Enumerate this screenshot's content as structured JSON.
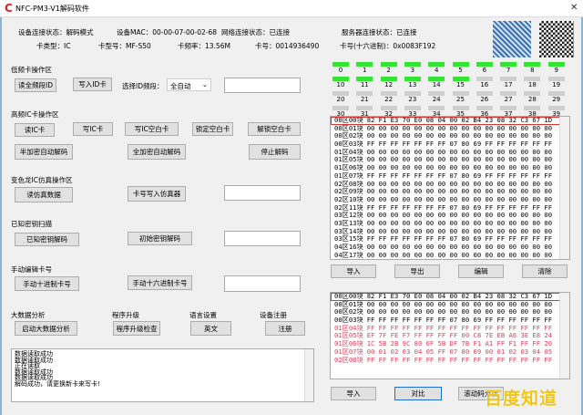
{
  "window": {
    "title": "NFC-PM3-V1解码软件",
    "close": "✕"
  },
  "info": {
    "device_status": "设备连接状态：解码模式",
    "mac": "设备MAC：00-00-07-00-02-68",
    "network_status": "网络连接状态：已连接",
    "server_status": "服务器连接状态：已连接",
    "card_type": "卡类型：IC",
    "card_model": "卡型号：MF-S50",
    "card_freq": "卡频率：13.56M",
    "card_no": "卡号：0014936490",
    "card_hex": "卡号(十六进制)：0x0083F192"
  },
  "lf": {
    "title": "低频卡操作区",
    "read_all": "读全频段ID",
    "write_id": "写入ID卡",
    "band_label": "选择ID频段：",
    "band_value": "全自动"
  },
  "hf": {
    "title": "高频IC卡操作区",
    "read_ic": "读IC卡",
    "write_ic": "写IC卡",
    "write_blank": "写IC空白卡",
    "lock_blank": "锁定空白卡",
    "unlock_blank": "解锁空白卡",
    "half_decode": "半加密自动解码",
    "full_decode": "全加密自动解码",
    "stop_decode": "停止解码"
  },
  "chameleon": {
    "title": "变色龙IC仿真操作区",
    "read_sim": "读仿真数据",
    "write_sim": "卡号写入仿真器"
  },
  "known_key": {
    "title": "已知密钥扫描",
    "known_decode": "已知密钥解码",
    "init_decode": "初始密钥解码"
  },
  "manual": {
    "title": "手动编辑卡号",
    "dec": "手动十进制卡号",
    "hex": "手动十六进制卡号"
  },
  "bottom_groups": {
    "bigdata_label": "大数据分析",
    "bigdata_btn": "启动大数据分析",
    "upgrade_label": "程序升级",
    "upgrade_btn": "程序升级检查",
    "lang_label": "语言设置",
    "lang_btn": "英文",
    "reg_label": "设备注册",
    "reg_btn": "注册"
  },
  "log": [
    "数据读取成功",
    "数据读取成功",
    "正在读取",
    "数据读取成功",
    "数据读取成功",
    "解码成功，请更换新卡来写卡!"
  ],
  "sectors": {
    "count": 40,
    "decoded": 16,
    "on_color": "#33e533",
    "off_color": "#cfcfcf"
  },
  "top_table": [
    {
      "label": "00区00块",
      "data": "82 F1 E3 70 E0 08 04 00 02 B4 23 08 32 C3 67 1D"
    },
    {
      "label": "00区01块",
      "data": "00 00 00 00 00 00 00 00 00 00 00 00 00 00 00 00"
    },
    {
      "label": "00区02块",
      "data": "00 00 00 00 00 00 00 00 00 00 00 00 00 00 00 00"
    },
    {
      "label": "00区03块",
      "data": "FF FF FF FF FF FF FF 07 80 69 FF FF FF FF FF FF"
    },
    {
      "label": "01区04块",
      "data": "00 00 00 00 00 00 00 00 00 00 00 00 00 00 00 00"
    },
    {
      "label": "01区05块",
      "data": "00 00 00 00 00 00 00 00 00 00 00 00 00 00 00 00"
    },
    {
      "label": "01区06块",
      "data": "00 00 00 00 00 00 00 00 00 00 00 00 00 00 00 00"
    },
    {
      "label": "01区07块",
      "data": "FF FF FF FF FF FF FF 07 80 69 FF FF FF FF FF FF"
    },
    {
      "label": "02区08块",
      "data": "00 00 00 00 00 00 00 00 00 00 00 00 00 00 00 00"
    },
    {
      "label": "02区09块",
      "data": "00 00 00 00 00 00 00 00 00 00 00 00 00 00 00 00"
    },
    {
      "label": "02区10块",
      "data": "00 00 00 00 00 00 00 00 00 00 00 00 00 00 00 00"
    },
    {
      "label": "02区11块",
      "data": "FF FF FF FF FF FF FF 07 80 69 FF FF FF FF FF FF"
    },
    {
      "label": "03区12块",
      "data": "00 00 00 00 00 00 00 00 00 00 00 00 00 00 00 00"
    },
    {
      "label": "03区13块",
      "data": "00 00 00 00 00 00 00 00 00 00 00 00 00 00 00 00"
    },
    {
      "label": "03区14块",
      "data": "00 00 00 00 00 00 00 00 00 00 00 00 00 00 00 00"
    },
    {
      "label": "03区15块",
      "data": "FF FF FF FF FF FF FF 07 80 69 FF FF FF FF FF FF"
    },
    {
      "label": "04区16块",
      "data": "00 00 00 00 00 00 00 00 00 00 00 00 00 00 00 00"
    },
    {
      "label": "04区17块",
      "data": "00 00 00 00 00 00 00 00 00 00 00 00 00 00 00 00"
    }
  ],
  "top_buttons": {
    "import": "导入",
    "export": "导出",
    "edit": "编辑",
    "clear": "清除"
  },
  "bottom_table": [
    {
      "label": "00区00块",
      "data": "82 F1 E3 70 E0 08 04 00 02 B4 23 08 32 C3 67 1D",
      "diff": false
    },
    {
      "label": "00区01块",
      "data": "00 00 00 00 00 00 00 00 00 00 00 00 00 00 00 00",
      "diff": false
    },
    {
      "label": "00区02块",
      "data": "00 00 00 00 00 00 00 00 00 00 00 00 00 00 00 00",
      "diff": false
    },
    {
      "label": "00区03块",
      "data": "FF FF FF FF FF FF FF 07 80 69 FF FF FF FF FF FF",
      "diff": false
    },
    {
      "label": "01区04块",
      "data": "FF FF FF FF FF FF FF FF FF FF FF FF FF FF FF FF",
      "diff": true
    },
    {
      "label": "01区05块",
      "data": "EF 7F FE F7 FF FF FF FF 00 C8 7E EB A6 3E E8 24",
      "diff": true
    },
    {
      "label": "01区06块",
      "data": "1C 5B 2B 9C 80 6F 5B DF 7B F1 A1 FF F1 FF FF 20",
      "diff": true
    },
    {
      "label": "01区07块",
      "data": "00 01 02 03 04 05 FF 07 80 69 00 01 02 03 04 05",
      "diff": true
    },
    {
      "label": "02区08块",
      "data": "FF FF FF FF FF FF FF FF FF FF FF FF FF FF FF FF",
      "diff": true
    }
  ],
  "bottom_buttons": {
    "import": "导入",
    "compare": "对比",
    "rolling": "滚动码分析"
  },
  "watermark": "百度知道"
}
